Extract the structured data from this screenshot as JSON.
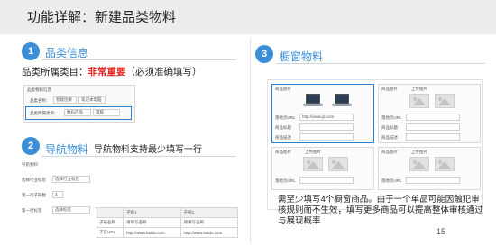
{
  "header": {
    "title": "功能详解：新建品类物料"
  },
  "sections": [
    {
      "number": "1",
      "title": "品类信息"
    },
    {
      "number": "2",
      "title": "导航物料"
    },
    {
      "number": "3",
      "title": "橱窗物料"
    }
  ],
  "category": {
    "note_prefix": "品类所属类目：",
    "note_emphasis": "非常重要",
    "note_suffix": "（必须准确填写）",
    "form_header": "品类物料信息",
    "name_label": "品类名称：",
    "name_value_1": "智能因果",
    "name_value_2": "笔记本电脑",
    "category_label": "品类所属类目：",
    "category_select_1": "数码产品",
    "category_select_2": "电脑"
  },
  "nav": {
    "note": "导航物料支持最少填写一行",
    "form_header": "导航物料",
    "industry_label": "选择行业标签",
    "industry_select": "选择行业标签",
    "count_label": "第一行子链数",
    "count_value": "3",
    "first_label": "第一行标签",
    "first_select": "选择标签",
    "table": {
      "headers": [
        "",
        "子链1",
        "子链2"
      ],
      "rows": [
        [
          "子链名称",
          "请填写名称",
          "请填写名称"
        ],
        [
          "子链URL",
          "http://www.baidu.com",
          "http://www.baidu.com"
        ]
      ]
    }
  },
  "window": {
    "card_title": "商品图片",
    "upload_label": "上传图片",
    "url_label": "落地页URL",
    "url_value": "http://www.jd.com",
    "title_label": "商品标题",
    "desc_label": "商品描述",
    "note": "需至少填写4个橱窗商品。由于一个单品可能因触犯审核规则而不生效，填写更多商品可以提高整体审核通过与展现概率",
    "page_number": "15"
  }
}
